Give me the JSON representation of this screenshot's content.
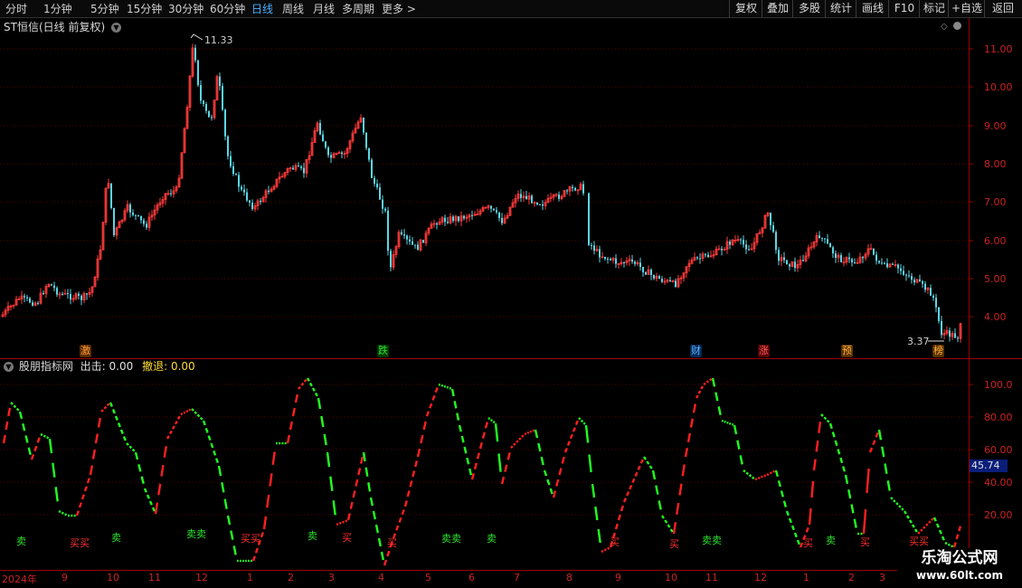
{
  "toolbar": {
    "periods": [
      "分时",
      "1分钟",
      "5分钟",
      "15分钟",
      "30分钟",
      "60分钟",
      "日线",
      "周线",
      "月线",
      "多周期",
      "更多"
    ],
    "active": "日线",
    "more_arrow": ">",
    "right_buttons": [
      "复权",
      "叠加",
      "多股",
      "统计",
      "画线",
      "F10",
      "标记",
      "+自选",
      "返回"
    ]
  },
  "chart_header": {
    "title": "ST恒信(日线 前复权)",
    "dropdown_icon": "chevron-down-icon",
    "diamond_icon": "diamond-icon"
  },
  "price_axis": {
    "ticks": [
      "11.00",
      "10.00",
      "9.00",
      "8.00",
      "7.00",
      "6.00",
      "5.00",
      "4.00"
    ]
  },
  "annotations": {
    "high": "11.33",
    "low": "3.37"
  },
  "events": [
    {
      "label": "激",
      "color": "#ff8c00"
    },
    {
      "label": "跌",
      "color": "#00c800"
    },
    {
      "label": "财",
      "color": "#3090ff"
    },
    {
      "label": "涨",
      "color": "#ff3030"
    },
    {
      "label": "预",
      "color": "#ff9900"
    },
    {
      "label": "榜",
      "color": "#ff9900"
    }
  ],
  "indicator": {
    "name": "股朋指标网",
    "out_label": "出击:",
    "out_value": "0.00",
    "retreat_label": "撤退:",
    "retreat_value": "0.00",
    "current_value": "45.74",
    "ticks": [
      "100.0",
      "80.00",
      "60.00",
      "40.00",
      "20.00"
    ]
  },
  "signals": {
    "buy": "买",
    "sell": "卖",
    "buy_pair": "买买",
    "sell_pair": "卖卖"
  },
  "x_axis": {
    "labels": [
      "2024年",
      "9",
      "10",
      "11",
      "12",
      "1",
      "2",
      "3",
      "4",
      "5",
      "6",
      "7",
      "8",
      "9",
      "10",
      "11",
      "12",
      "1",
      "2",
      "3"
    ]
  },
  "watermark": {
    "title": "乐淘公式网",
    "url": "www.60lt.com"
  },
  "colors": {
    "up": "#ff3b3b",
    "down": "#5ad6e6",
    "ind_up": "#ff2020",
    "ind_down": "#20ff20",
    "grid": "#5a0000"
  }
}
